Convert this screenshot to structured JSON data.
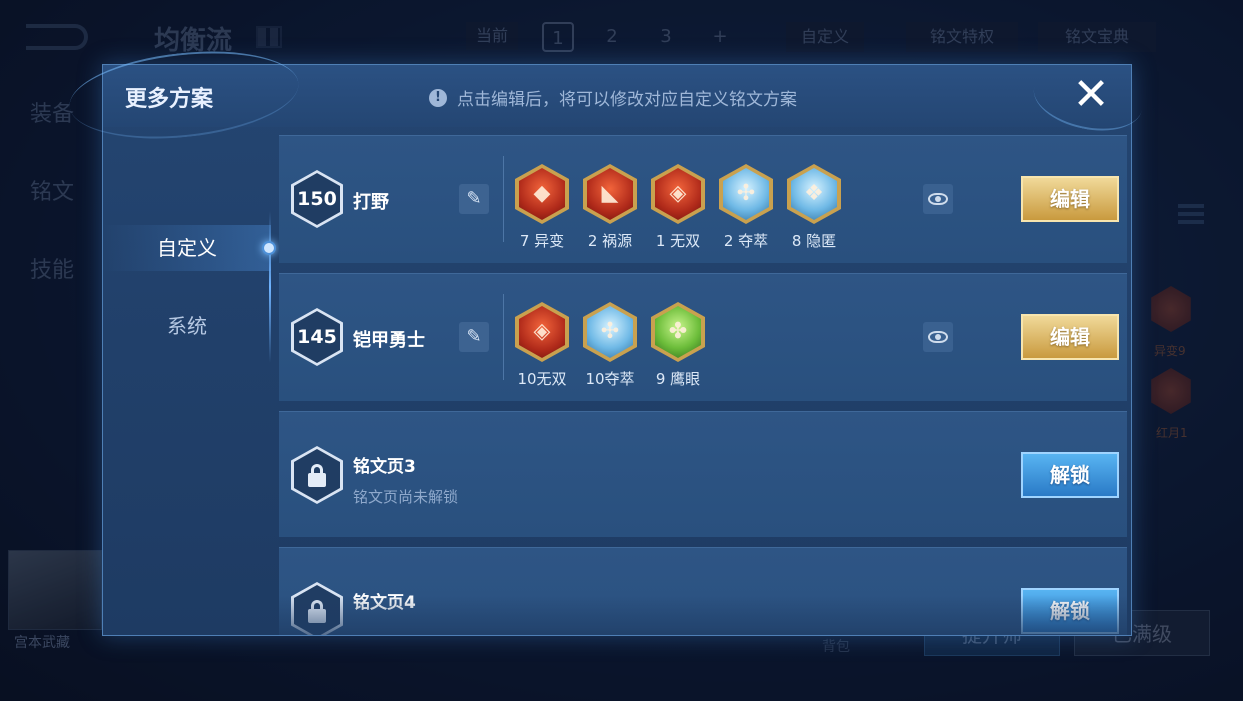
{
  "background": {
    "title": "均衡流",
    "current_label": "当前",
    "pages": [
      "1",
      "2",
      "3",
      "+"
    ],
    "custom_label": "自定义",
    "trait_label": "铭文特权",
    "dict_label": "铭文宝典",
    "side_items": [
      "装备",
      "铭文",
      "技能"
    ],
    "hero_name": "宫本武藏",
    "bag_label": "背包",
    "btn_left": "提升师",
    "btn_right": "已满级",
    "rune_labels": [
      "异变9",
      "红月1"
    ]
  },
  "modal": {
    "title": "更多方案",
    "hint": "点击编辑后，将可以修改对应自定义铭文方案",
    "close_glyph": "✕",
    "tabs": [
      {
        "label": "自定义",
        "active": true
      },
      {
        "label": "系统",
        "active": false
      }
    ],
    "rows": [
      {
        "level": "150",
        "name": "打野",
        "edit_label": "编辑",
        "runes": [
          {
            "label": "7 异变",
            "color": "red"
          },
          {
            "label": "2 祸源",
            "color": "red"
          },
          {
            "label": "1 无双",
            "color": "red"
          },
          {
            "label": "2 夺萃",
            "color": "blue"
          },
          {
            "label": "8 隐匿",
            "color": "blue"
          }
        ]
      },
      {
        "level": "145",
        "name": "铠甲勇士",
        "edit_label": "编辑",
        "runes": [
          {
            "label": "10无双",
            "color": "red"
          },
          {
            "label": "10夺萃",
            "color": "blue"
          },
          {
            "label": "9 鹰眼",
            "color": "green"
          }
        ]
      }
    ],
    "locked_pages": [
      {
        "title": "铭文页3",
        "subtitle": "铭文页尚未解锁",
        "unlock_label": "解锁"
      },
      {
        "title": "铭文页4",
        "subtitle": "",
        "unlock_label": "解锁"
      }
    ]
  },
  "icons": {
    "info": "info-icon",
    "rename": "pencil-icon",
    "preview": "eye-icon",
    "lock": "lock-icon",
    "close": "close-icon"
  },
  "colors": {
    "edit_button": "#d9b25c",
    "unlock_button": "#3f97dd",
    "panel": "#244571"
  }
}
